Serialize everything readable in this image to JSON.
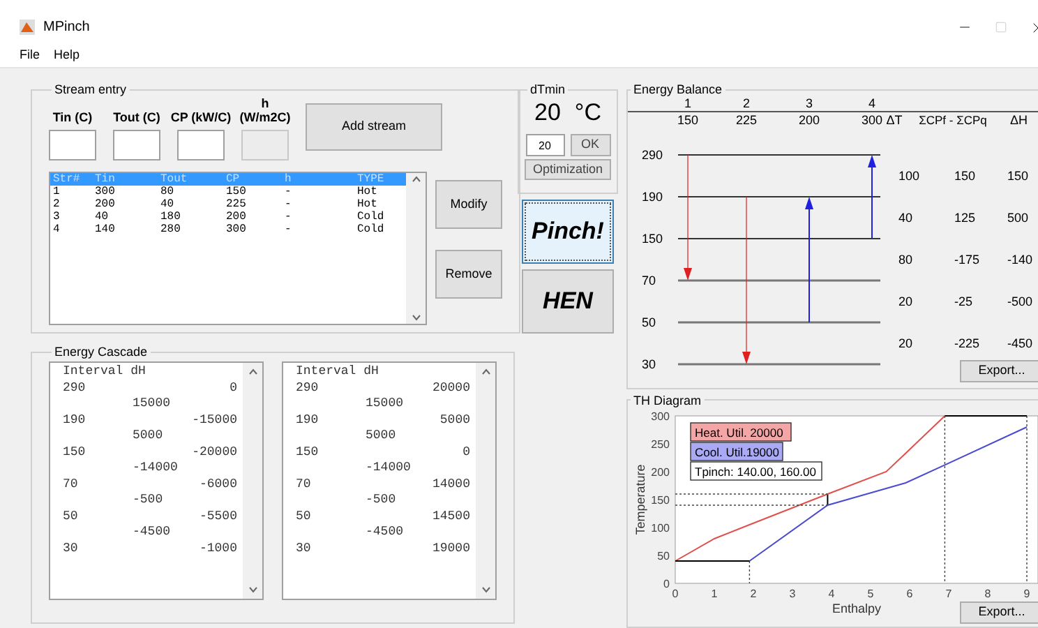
{
  "window": {
    "title": "MPinch"
  },
  "menu": [
    "File",
    "Help"
  ],
  "stream_entry": {
    "title": "Stream entry",
    "fields": [
      {
        "label": "Tin (C)",
        "disabled": false
      },
      {
        "label": "Tout (C)",
        "disabled": false
      },
      {
        "label": "CP (kW/C)",
        "disabled": false
      },
      {
        "label": "h (W/m2C)",
        "disabled": true
      }
    ],
    "add_button": "Add stream",
    "table": {
      "columns": [
        "Str#",
        "Tin",
        "Tout",
        "CP",
        "h",
        "TYPE"
      ],
      "header_selected": true,
      "rows": [
        {
          "cells": [
            "1",
            "300",
            "80",
            "150",
            "-",
            "Hot"
          ],
          "selected": false
        },
        {
          "cells": [
            "2",
            "200",
            "40",
            "225",
            "-",
            "Hot"
          ],
          "selected": false
        },
        {
          "cells": [
            "3",
            "40",
            "180",
            "200",
            "-",
            "Cold"
          ],
          "selected": false
        },
        {
          "cells": [
            "4",
            "140",
            "280",
            "300",
            "-",
            "Cold"
          ],
          "selected": false
        }
      ]
    },
    "modify_button": "Modify",
    "remove_button": "Remove"
  },
  "dtmin": {
    "title": "dTmin",
    "value": "20",
    "unit": "°C",
    "field_value": "20",
    "ok_button": "OK",
    "optimization_button": "Optimization"
  },
  "pinch_button": {
    "label": "Pinch!",
    "focused": true
  },
  "hen_button": {
    "label": "HEN",
    "focused": false
  },
  "energy_cascade": {
    "title": "Energy Cascade",
    "lists": [
      {
        "header": "Interval dH",
        "rows": [
          {
            "kind": "temp",
            "label": "290",
            "value": "0"
          },
          {
            "kind": "interval",
            "value": "15000"
          },
          {
            "kind": "temp",
            "label": "190",
            "value": "-15000"
          },
          {
            "kind": "interval",
            "value": "5000"
          },
          {
            "kind": "temp",
            "label": "150",
            "value": "-20000"
          },
          {
            "kind": "interval",
            "value": "-14000"
          },
          {
            "kind": "temp",
            "label": "70",
            "value": "-6000"
          },
          {
            "kind": "interval",
            "value": "-500"
          },
          {
            "kind": "temp",
            "label": "50",
            "value": "-5500"
          },
          {
            "kind": "interval",
            "value": "-4500"
          },
          {
            "kind": "temp",
            "label": "30",
            "value": "-1000"
          }
        ]
      },
      {
        "header": "Interval dH",
        "rows": [
          {
            "kind": "temp",
            "label": "290",
            "value": "20000"
          },
          {
            "kind": "interval",
            "value": "15000"
          },
          {
            "kind": "temp",
            "label": "190",
            "value": "5000"
          },
          {
            "kind": "interval",
            "value": "5000"
          },
          {
            "kind": "temp",
            "label": "150",
            "value": "0"
          },
          {
            "kind": "interval",
            "value": "-14000"
          },
          {
            "kind": "temp",
            "label": "70",
            "value": "14000"
          },
          {
            "kind": "interval",
            "value": "-500"
          },
          {
            "kind": "temp",
            "label": "50",
            "value": "14500"
          },
          {
            "kind": "interval",
            "value": "-4500"
          },
          {
            "kind": "temp",
            "label": "30",
            "value": "19000"
          }
        ]
      }
    ]
  },
  "energy_balance": {
    "title": "Energy Balance",
    "streams": [
      {
        "number": "1",
        "cp": "150",
        "kind": "hot"
      },
      {
        "number": "2",
        "cp": "225",
        "kind": "hot"
      },
      {
        "number": "3",
        "cp": "200",
        "kind": "cold"
      },
      {
        "number": "4",
        "cp": "300",
        "kind": "cold"
      }
    ],
    "columns": [
      "ΔT",
      "ΣCPf - ΣCPq",
      "ΔH"
    ],
    "levels": [
      "290",
      "190",
      "150",
      "70",
      "50",
      "30"
    ],
    "intervals": [
      {
        "dt": "100",
        "sum": "150",
        "dh": "150"
      },
      {
        "dt": "40",
        "sum": "125",
        "dh": "500"
      },
      {
        "dt": "80",
        "sum": "-175",
        "dh": "-140"
      },
      {
        "dt": "20",
        "sum": "-25",
        "dh": "-500"
      },
      {
        "dt": "20",
        "sum": "-225",
        "dh": "-450"
      }
    ],
    "export_button": "Export..."
  },
  "th_diagram": {
    "title": "TH Diagram",
    "labels": [
      {
        "text": "Heat. Util.  20000",
        "color": "#f4a6a6"
      },
      {
        "text": "Cool. Util.19000",
        "color": "#a9a9f4"
      },
      {
        "text": "Tpinch: 140.00, 160.00",
        "color": "#ffffff"
      }
    ],
    "chart_data": {
      "type": "line",
      "xlabel": "Enthalpy",
      "ylabel": "Temperature",
      "x": [
        0,
        1,
        1.9,
        3.9,
        5.4,
        5.9,
        6.9,
        9
      ],
      "series": [
        {
          "color": "#e0504a",
          "values": [
            40,
            80,
            105,
            160,
            200,
            233,
            300,
            null
          ]
        },
        {
          "color": "#4a4ad0",
          "values": [
            null,
            null,
            40,
            140,
            170,
            180,
            212,
            280
          ]
        },
        {
          "color": "#000000",
          "values": [
            40,
            40,
            40,
            null,
            null,
            null,
            null,
            null
          ]
        },
        {
          "color": "#000000",
          "values": [
            null,
            null,
            null,
            null,
            null,
            null,
            300,
            300
          ]
        },
        {
          "color": "#444444",
          "line_style": "dashed",
          "values": [
            160,
            160,
            160,
            160,
            null,
            null,
            null,
            null
          ]
        },
        {
          "color": "#444444",
          "line_style": "dashed",
          "values": [
            140,
            140,
            140,
            140,
            null,
            null,
            null,
            null
          ]
        }
      ],
      "ref_lines": [
        {
          "axis": "x",
          "value": 1.9
        },
        {
          "axis": "x",
          "value": 6.9
        },
        {
          "axis": "x",
          "value": 9
        }
      ],
      "xlim": [
        0,
        9
      ],
      "ylim": [
        0,
        300
      ],
      "xticks": [
        0,
        1,
        2,
        3,
        4,
        5,
        6,
        7,
        8,
        9
      ],
      "yticks": [
        0,
        50,
        100,
        150,
        200,
        250,
        300
      ]
    },
    "export_button": "Export..."
  }
}
